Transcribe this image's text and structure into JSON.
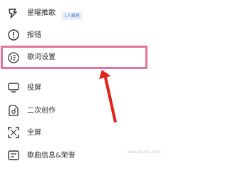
{
  "menu": {
    "items": [
      {
        "label": "星曜推歌",
        "icon": "star-pointer-icon",
        "badge": "1人推荐"
      },
      {
        "label": "报错",
        "icon": "warning-icon"
      },
      {
        "label": "歌词设置",
        "icon": "lyrics-settings-icon"
      },
      {
        "label": "投屏",
        "icon": "cast-screen-icon"
      },
      {
        "label": "二次创作",
        "icon": "secondary-creation-icon"
      },
      {
        "label": "全屏",
        "icon": "fullscreen-icon"
      },
      {
        "label": "歌曲信息&荣誉",
        "icon": "song-info-icon"
      }
    ]
  },
  "annotation": {
    "highlight_color": "#e8729c",
    "arrow_color": "#e0241c"
  },
  "watermark": "www.baidu.com"
}
